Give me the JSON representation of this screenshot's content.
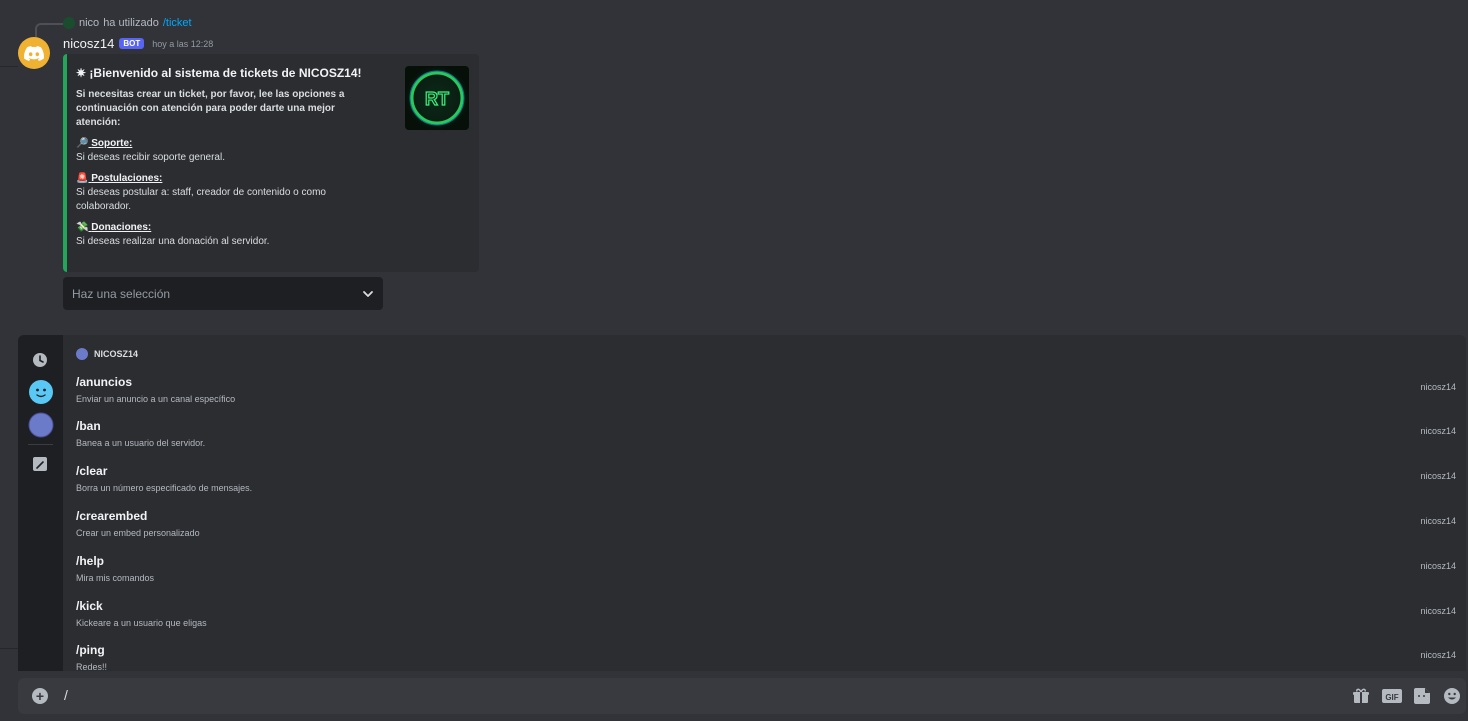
{
  "reply": {
    "user": "nico",
    "action": "ha utilizado",
    "command": "/ticket"
  },
  "message": {
    "username": "nicosz14",
    "badge": "BOT",
    "timestamp": "hoy a las 12:28"
  },
  "embed": {
    "color": "#23a55a",
    "title": "¡Bienvenido al sistema de tickets de NICOSZ14!",
    "title_icon": "✷",
    "description": "Si necesitas crear un ticket, por favor, lee las opciones a continuación con atención para poder darte una mejor atención:",
    "thumbnail_text": "RT",
    "fields": [
      {
        "icon": "🔎",
        "name": "Soporte:",
        "value": "Si deseas recibir soporte general."
      },
      {
        "icon": "🚨",
        "name": "Postulaciones:",
        "value": "Si deseas postular a: staff, creador de contenido o como colaborador."
      },
      {
        "icon": "💸",
        "name": "Donaciones:",
        "value": "Si deseas realizar una donación al servidor."
      }
    ]
  },
  "select": {
    "placeholder": "Haz una selección"
  },
  "autocomplete": {
    "section": "NICOSZ14",
    "commands": [
      {
        "name": "/anuncios",
        "desc": "Enviar un anuncio a un canal específico",
        "source": "nicosz14"
      },
      {
        "name": "/ban",
        "desc": "Banea a un usuario del servidor.",
        "source": "nicosz14"
      },
      {
        "name": "/clear",
        "desc": "Borra un número especificado de mensajes.",
        "source": "nicosz14"
      },
      {
        "name": "/crearembed",
        "desc": "Crear un embed personalizado",
        "source": "nicosz14"
      },
      {
        "name": "/help",
        "desc": "Mira mis comandos",
        "source": "nicosz14"
      },
      {
        "name": "/kick",
        "desc": "Kickeare a un usuario que eligas",
        "source": "nicosz14"
      },
      {
        "name": "/ping",
        "desc": "Redes!!",
        "source": "nicosz14"
      }
    ]
  },
  "chat": {
    "input_value": "/"
  }
}
